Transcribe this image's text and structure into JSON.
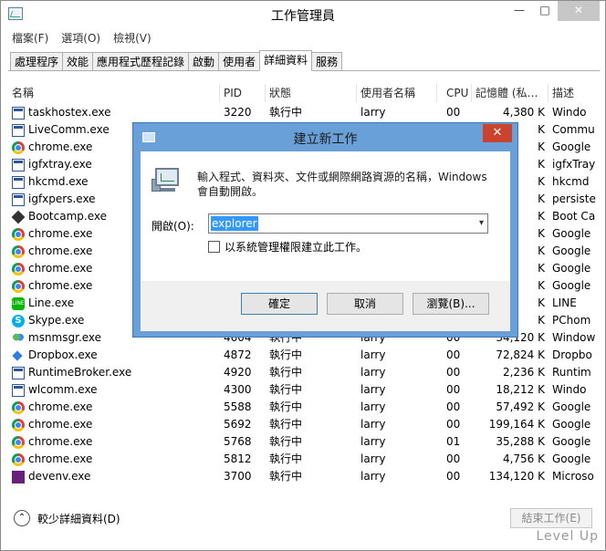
{
  "window": {
    "title": "工作管理員"
  },
  "menu": [
    "檔案(F)",
    "選項(O)",
    "檢視(V)"
  ],
  "tabs": [
    "處理程序",
    "效能",
    "應用程式歷程記錄",
    "啟動",
    "使用者",
    "詳細資料",
    "服務"
  ],
  "active_tab": "詳細資料",
  "columns": {
    "name": "名稱",
    "pid": "PID",
    "status": "狀態",
    "user": "使用者名稱",
    "cpu": "CPU",
    "memory": "記憶體 (私…",
    "desc": "描述"
  },
  "processes": [
    {
      "name": "taskhostex.exe",
      "icon": "app-icon",
      "pid": "3220",
      "status": "執行中",
      "user": "larry",
      "cpu": "00",
      "memory": "4,380 K",
      "desc": "Windo"
    },
    {
      "name": "LiveComm.exe",
      "icon": "app-icon",
      "pid": "",
      "status": "",
      "user": "",
      "cpu": "",
      "memory": "K",
      "desc": "Commu"
    },
    {
      "name": "chrome.exe",
      "icon": "chrome-icon",
      "pid": "",
      "status": "",
      "user": "",
      "cpu": "",
      "memory": "K",
      "desc": "Google"
    },
    {
      "name": "igfxtray.exe",
      "icon": "app-icon",
      "pid": "",
      "status": "",
      "user": "",
      "cpu": "",
      "memory": "K",
      "desc": "igfxTray"
    },
    {
      "name": "hkcmd.exe",
      "icon": "app-icon",
      "pid": "",
      "status": "",
      "user": "",
      "cpu": "",
      "memory": "K",
      "desc": "hkcmd"
    },
    {
      "name": "igfxpers.exe",
      "icon": "app-icon",
      "pid": "",
      "status": "",
      "user": "",
      "cpu": "",
      "memory": "K",
      "desc": "persiste"
    },
    {
      "name": "Bootcamp.exe",
      "icon": "bootcamp-icon",
      "pid": "",
      "status": "",
      "user": "",
      "cpu": "",
      "memory": "K",
      "desc": "Boot Ca"
    },
    {
      "name": "chrome.exe",
      "icon": "chrome-icon",
      "pid": "",
      "status": "",
      "user": "",
      "cpu": "",
      "memory": "K",
      "desc": "Google"
    },
    {
      "name": "chrome.exe",
      "icon": "chrome-icon",
      "pid": "",
      "status": "",
      "user": "",
      "cpu": "",
      "memory": "K",
      "desc": "Google"
    },
    {
      "name": "chrome.exe",
      "icon": "chrome-icon",
      "pid": "",
      "status": "",
      "user": "",
      "cpu": "",
      "memory": "K",
      "desc": "Google"
    },
    {
      "name": "chrome.exe",
      "icon": "chrome-icon",
      "pid": "",
      "status": "",
      "user": "",
      "cpu": "",
      "memory": "K",
      "desc": "Google"
    },
    {
      "name": "Line.exe",
      "icon": "line-icon",
      "pid": "",
      "status": "",
      "user": "",
      "cpu": "",
      "memory": "K",
      "desc": "LINE"
    },
    {
      "name": "Skype.exe",
      "icon": "skype-icon",
      "pid": "",
      "status": "",
      "user": "",
      "cpu": "",
      "memory": "K",
      "desc": "PChom"
    },
    {
      "name": "msnmsgr.exe",
      "icon": "msn-icon",
      "pid": "4604",
      "status": "執行中",
      "user": "larry",
      "cpu": "00",
      "memory": "34,120 K",
      "desc": "Window"
    },
    {
      "name": "Dropbox.exe",
      "icon": "dropbox-icon",
      "pid": "4872",
      "status": "執行中",
      "user": "larry",
      "cpu": "00",
      "memory": "72,824 K",
      "desc": "Dropbo"
    },
    {
      "name": "RuntimeBroker.exe",
      "icon": "app-icon",
      "pid": "4920",
      "status": "執行中",
      "user": "larry",
      "cpu": "00",
      "memory": "2,236 K",
      "desc": "Runtim"
    },
    {
      "name": "wlcomm.exe",
      "icon": "app-icon",
      "pid": "4300",
      "status": "執行中",
      "user": "larry",
      "cpu": "00",
      "memory": "18,212 K",
      "desc": "Windo"
    },
    {
      "name": "chrome.exe",
      "icon": "chrome-icon",
      "pid": "5588",
      "status": "執行中",
      "user": "larry",
      "cpu": "00",
      "memory": "57,492 K",
      "desc": "Google"
    },
    {
      "name": "chrome.exe",
      "icon": "chrome-icon",
      "pid": "5692",
      "status": "執行中",
      "user": "larry",
      "cpu": "00",
      "memory": "199,164 K",
      "desc": "Google"
    },
    {
      "name": "chrome.exe",
      "icon": "chrome-icon",
      "pid": "5768",
      "status": "執行中",
      "user": "larry",
      "cpu": "01",
      "memory": "35,288 K",
      "desc": "Google"
    },
    {
      "name": "chrome.exe",
      "icon": "chrome-icon",
      "pid": "5812",
      "status": "執行中",
      "user": "larry",
      "cpu": "00",
      "memory": "4,756 K",
      "desc": "Google"
    },
    {
      "name": "devenv.exe",
      "icon": "visual-studio-icon",
      "pid": "3700",
      "status": "執行中",
      "user": "larry",
      "cpu": "00",
      "memory": "134,120 K",
      "desc": "Microso"
    }
  ],
  "footer": {
    "fewer_details": "較少詳細資料(D)",
    "end_task": "結束工作(E)"
  },
  "dialog": {
    "title": "建立新工作",
    "description": "輸入程式、資料夾、文件或網際網路資源的名稱，Windows 會自動開啟。",
    "open_label": "開啟(O):",
    "open_value": "explorer",
    "admin_label": "以系統管理權限建立此工作。",
    "ok": "確定",
    "cancel": "取消",
    "browse": "瀏覽(B)..."
  },
  "watermark": "Level Up"
}
